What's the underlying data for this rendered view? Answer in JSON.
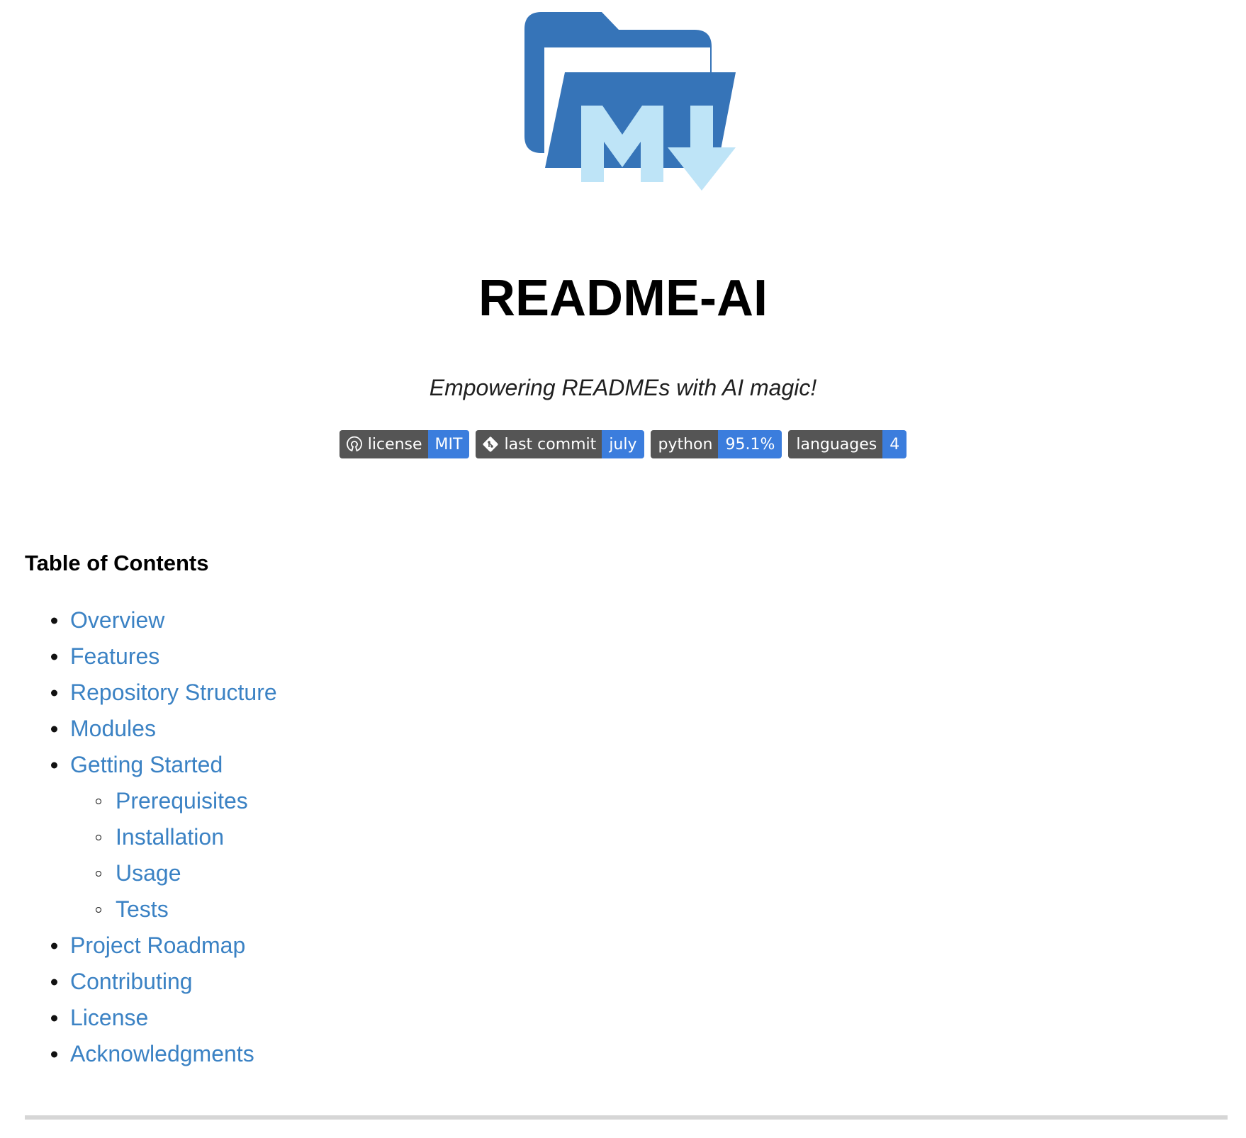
{
  "title": "README-AI",
  "tagline": "Empowering READMEs with AI magic!",
  "colors": {
    "logo_folder": "#3674b8",
    "logo_glyph": "#bee4f7",
    "badge_label_bg": "#555555",
    "badge_value_bg": "#3b7ddd",
    "link": "#3b82c4",
    "rule": "#d6d6d6"
  },
  "logo": {
    "icon": "folder-markdown-logo-icon"
  },
  "badges": [
    {
      "label": "license",
      "value": "MIT",
      "icon": "opensource-icon"
    },
    {
      "label": "last commit",
      "value": "july",
      "icon": "git-icon"
    },
    {
      "label": "python",
      "value": "95.1%",
      "icon": ""
    },
    {
      "label": "languages",
      "value": "4",
      "icon": ""
    }
  ],
  "toc": {
    "heading": "Table of Contents",
    "items": [
      {
        "label": "Overview",
        "level": 1
      },
      {
        "label": "Features",
        "level": 1
      },
      {
        "label": "Repository Structure",
        "level": 1
      },
      {
        "label": "Modules",
        "level": 1
      },
      {
        "label": "Getting Started",
        "level": 1
      },
      {
        "label": "Prerequisites",
        "level": 2
      },
      {
        "label": "Installation",
        "level": 2
      },
      {
        "label": "Usage",
        "level": 2
      },
      {
        "label": "Tests",
        "level": 2
      },
      {
        "label": "Project Roadmap",
        "level": 1
      },
      {
        "label": "Contributing",
        "level": 1
      },
      {
        "label": "License",
        "level": 1
      },
      {
        "label": "Acknowledgments",
        "level": 1
      }
    ]
  }
}
